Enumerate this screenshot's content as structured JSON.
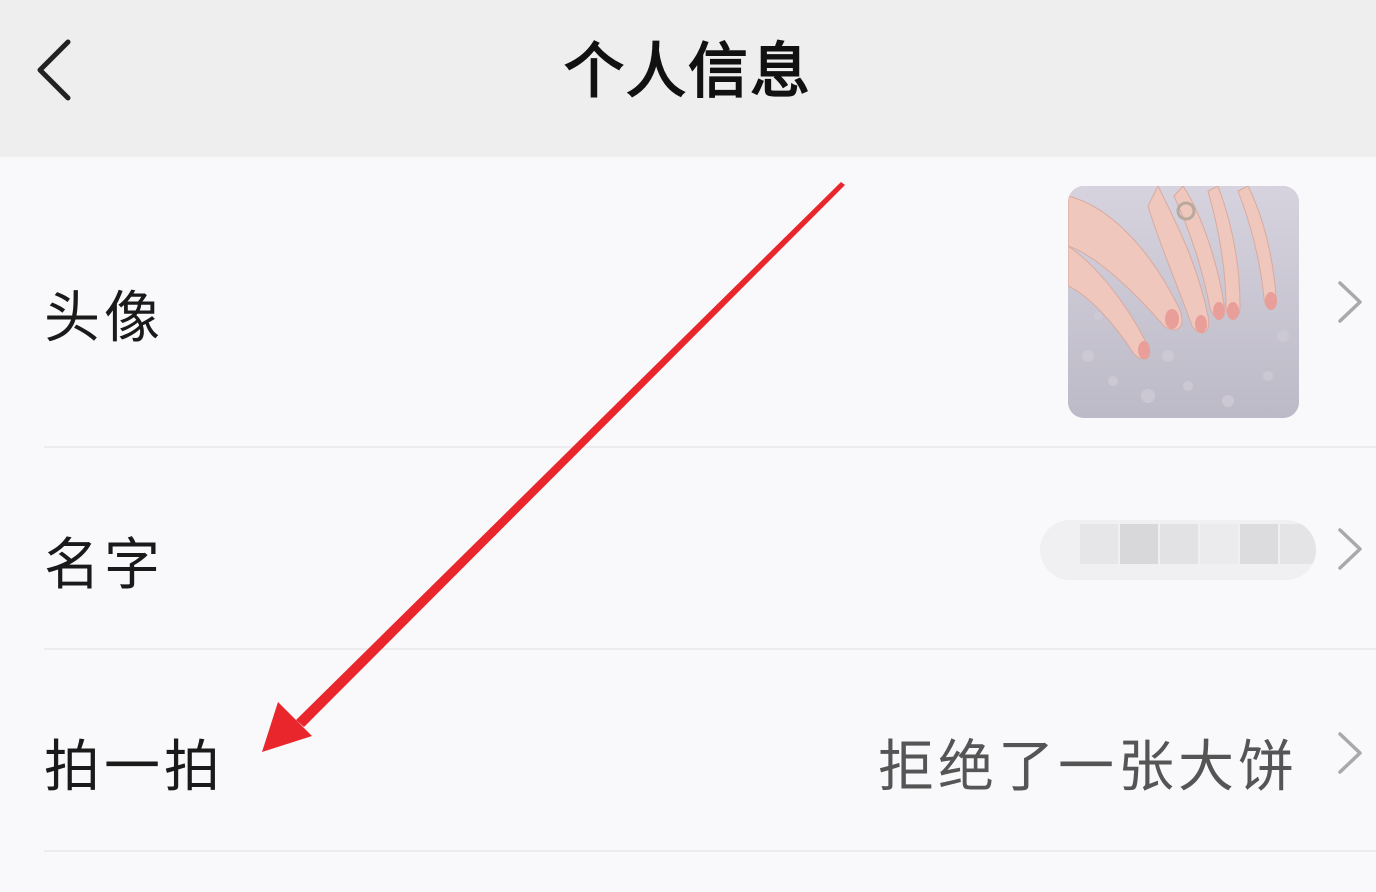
{
  "header": {
    "title": "个人信息",
    "back_icon": "chevron-left-icon"
  },
  "rows": [
    {
      "label": "头像",
      "value_type": "avatar-image"
    },
    {
      "label": "名字",
      "value_type": "blurred-name"
    },
    {
      "label": "拍一拍",
      "value": "拒绝了一张大饼"
    }
  ],
  "colors": {
    "header_bg": "#eeeeef",
    "page_bg": "#f9f9fb",
    "annotation_arrow": "#e8262b"
  }
}
